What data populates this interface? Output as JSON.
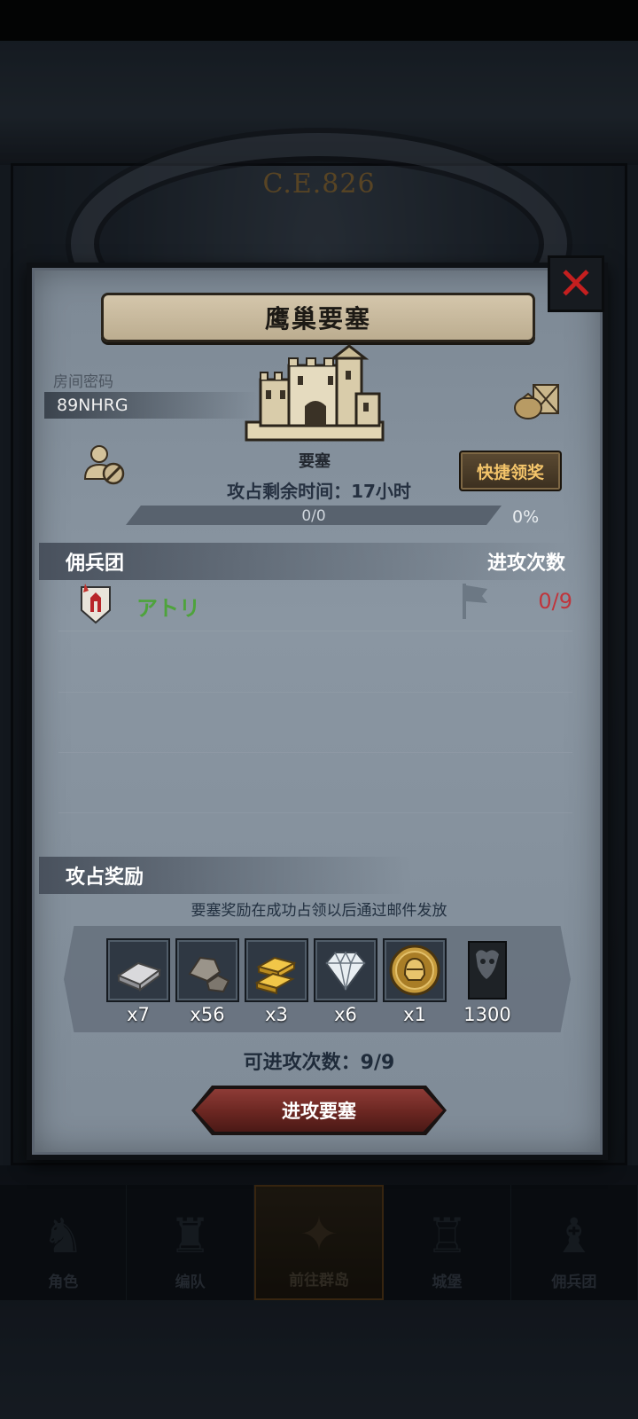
{
  "background": {
    "era": "C.E.826",
    "nav": [
      {
        "label": "角色",
        "icon": "knight-icon",
        "active": false
      },
      {
        "label": "编队",
        "icon": "formation-icon",
        "active": false
      },
      {
        "label": "前往群岛",
        "icon": "compass-icon",
        "active": true
      },
      {
        "label": "城堡",
        "icon": "castle-tower-icon",
        "active": false
      },
      {
        "label": "佣兵团",
        "icon": "mercenary-icon",
        "active": false
      }
    ]
  },
  "dialog": {
    "title": "鹰巢要塞",
    "room_code_label": "房间密码",
    "room_code": "89NHRG",
    "fortress_label": "要塞",
    "time_left": "攻占剩余时间：17小时",
    "quick_claim": "快捷领奖",
    "progress": {
      "text": "0/0",
      "percent_text": "0%",
      "fraction": 0
    },
    "mercs_header": "佣兵团",
    "attacks_header": "进攻次数",
    "merc_rows": [
      {
        "name": "アトリ",
        "attacks": "0/9"
      }
    ],
    "rewards_header": "攻占奖励",
    "reward_note": "要塞奖励在成功占领以后通过邮件发放",
    "rewards": [
      {
        "icon": "iron-ingot-icon",
        "qty": "x7"
      },
      {
        "icon": "stone-icon",
        "qty": "x56"
      },
      {
        "icon": "gold-bar-icon",
        "qty": "x3"
      },
      {
        "icon": "diamond-icon",
        "qty": "x6"
      },
      {
        "icon": "helmet-coin-icon",
        "qty": "x1"
      },
      {
        "icon": "demon-banner-icon",
        "qty": "1300"
      }
    ],
    "attacks_available": "可进攻次数：9/9",
    "attack_button": "进攻要塞"
  },
  "colors": {
    "accent_gold": "#f3c46a",
    "attack_red": "#c0353c",
    "merc_green": "#4ea33c",
    "close_red": "#c41f1f"
  }
}
